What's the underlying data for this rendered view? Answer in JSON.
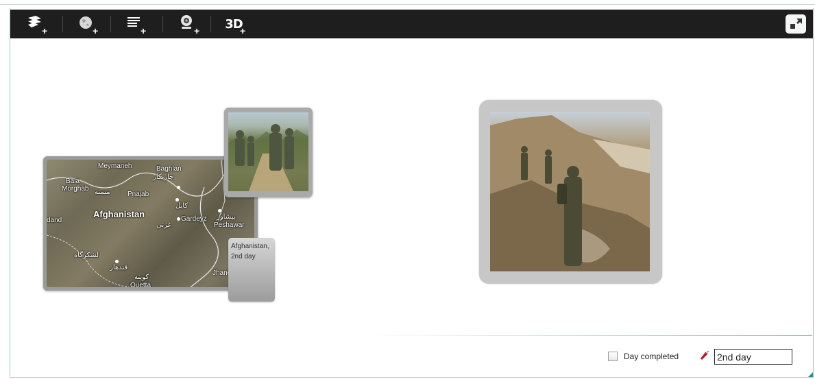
{
  "toolbar": {
    "buttons": [
      {
        "name": "add-layout-button",
        "icon": "layout-icon"
      },
      {
        "name": "add-globe-button",
        "icon": "globe-icon"
      },
      {
        "name": "add-list-button",
        "icon": "list-icon"
      },
      {
        "name": "add-webcam-button",
        "icon": "webcam-icon"
      },
      {
        "name": "add-3d-button",
        "icon": "3d-icon",
        "label": "3D"
      }
    ],
    "plus": "+",
    "fullscreen_icon": "fullscreen-icon"
  },
  "map": {
    "labels": [
      "Meymaneh",
      "Baghlan",
      "Bala",
      "Morghab",
      "Pnajab",
      "Afghanistan",
      "dand",
      "Gardeyz",
      "Peshawar",
      "Jhang",
      "Quetta"
    ],
    "arabic_labels": [
      "چاریکار",
      "میمنه",
      "کابل",
      "غزنی",
      "پیشاور",
      "لشکرگاه",
      "قندهار",
      "کویته"
    ]
  },
  "label_card": {
    "text": "Afghanistan, 2nd day"
  },
  "footer": {
    "day_completed_label": "Day completed",
    "name_value": "2nd day"
  },
  "colors": {
    "toolbar": "#1e1e1e",
    "accent": "#2e8b87",
    "marker": "#b0192b"
  }
}
